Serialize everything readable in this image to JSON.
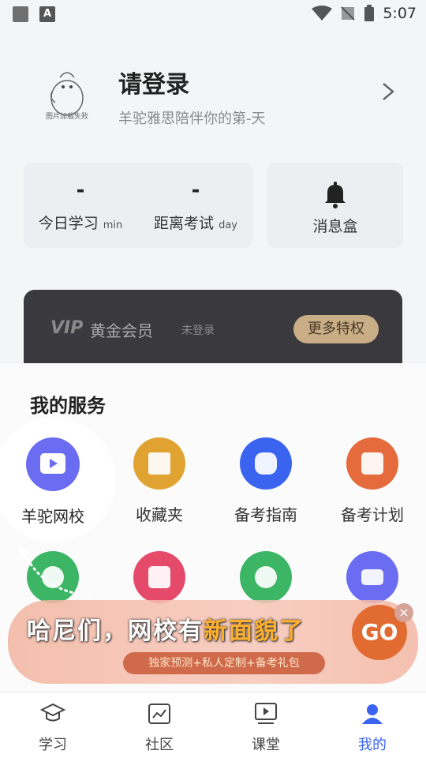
{
  "status_bar": {
    "time": "5:07"
  },
  "profile": {
    "avatar_caption": "图片加载失败",
    "title": "请登录",
    "subtitle": "羊驼雅思陪伴你的第-天"
  },
  "stats": {
    "study": {
      "value": "-",
      "label": "今日学习",
      "unit": "min"
    },
    "exam": {
      "value": "-",
      "label": "距离考试",
      "unit": "day"
    },
    "inbox": {
      "label": "消息盒"
    }
  },
  "vip": {
    "badge": "VIP",
    "title": "黄金会员",
    "status": "未登录",
    "button": "更多特权"
  },
  "services": {
    "title": "我的服务",
    "items": [
      {
        "label": "羊驼网校",
        "color": "#6a6cf2",
        "icon": "tv-icon"
      },
      {
        "label": "收藏夹",
        "color": "#e0a332",
        "icon": "folder-icon"
      },
      {
        "label": "备考指南",
        "color": "#3a63f0",
        "icon": "guide-icon"
      },
      {
        "label": "备考计划",
        "color": "#e56a3c",
        "icon": "clipboard-icon"
      }
    ],
    "row2_colors": [
      "#3cb565",
      "#e54a6a",
      "#3cb565",
      "#6a6cf2"
    ]
  },
  "banner": {
    "text_before": "哈尼们，网校有",
    "text_accent": "新面貌了",
    "subtitle": "独家预测+私人定制+备考礼包",
    "go": "GO",
    "close": "×"
  },
  "tabs": [
    {
      "label": "学习",
      "icon": "graduation-cap-icon"
    },
    {
      "label": "社区",
      "icon": "chart-board-icon"
    },
    {
      "label": "课堂",
      "icon": "play-screen-icon"
    },
    {
      "label": "我的",
      "icon": "user-icon",
      "active": true
    }
  ],
  "colors": {
    "accent": "#3a63f0",
    "vip_gold": "#c8ad86"
  }
}
